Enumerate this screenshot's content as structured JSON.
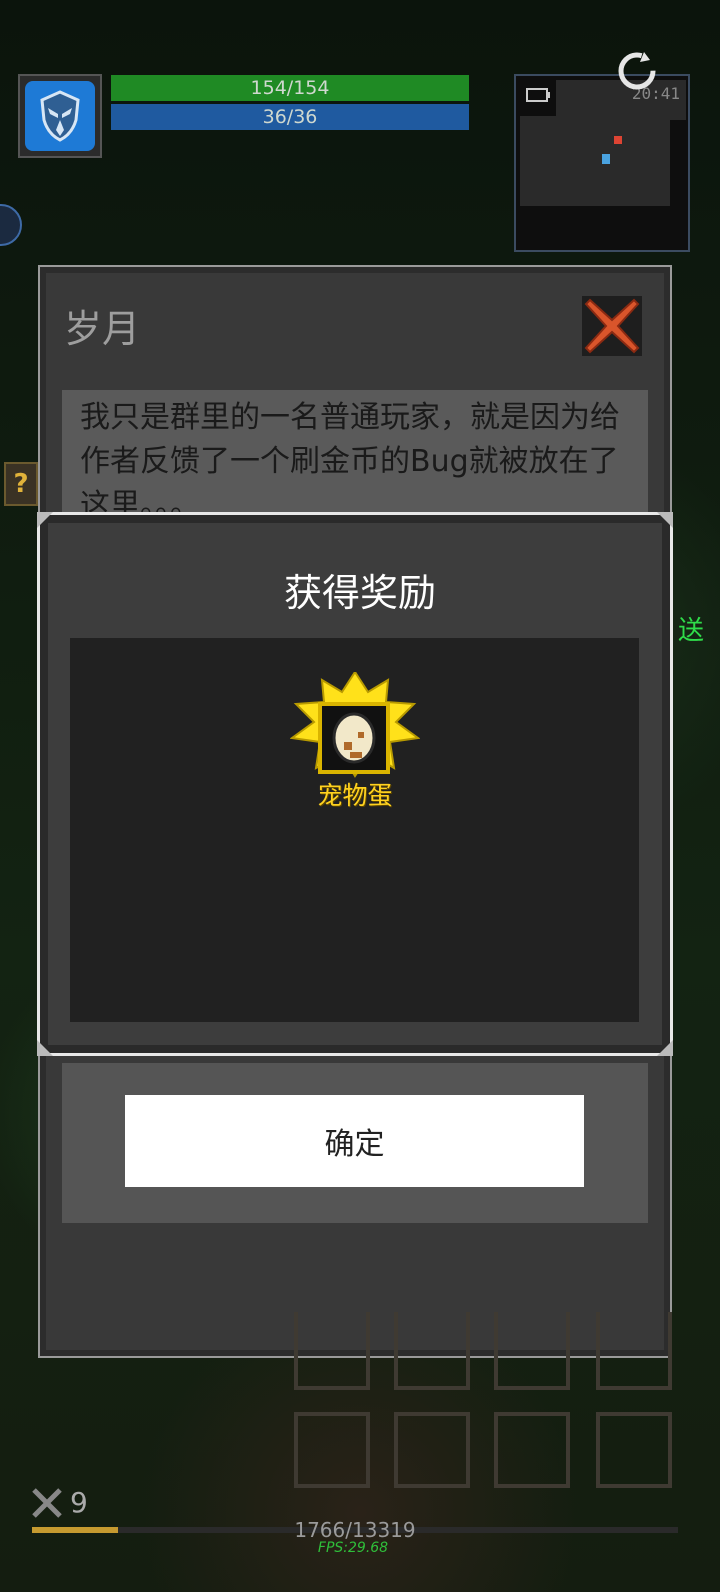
{
  "hud": {
    "hp_text": "154/154",
    "mp_text": "36/36",
    "clock": "20:41",
    "avatar_icon": "shield-mask-icon"
  },
  "dialog": {
    "title": "岁月",
    "body": "我只是群里的一名普通玩家，就是因为给作者反馈了一个刷金币的Bug就被放在了这里。。。",
    "confirm_label": "确定"
  },
  "reward": {
    "title": "获得奖励",
    "item_name": "宠物蛋",
    "item_icon": "pet-egg-icon"
  },
  "edge": {
    "right_text": "送",
    "left_icon_text": "?"
  },
  "footer": {
    "level": "9",
    "xp_text": "1766/13319",
    "xp_fraction": 0.133,
    "fps": "FPS:29.68"
  },
  "colors": {
    "hp_bar": "#1f8a24",
    "mp_bar": "#1f5aa0",
    "item_label": "#ffd21f",
    "fps_text": "#2fbf3a"
  }
}
